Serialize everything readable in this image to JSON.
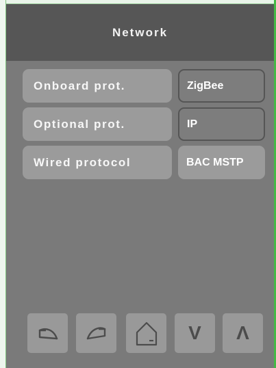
{
  "header": {
    "title": "Network"
  },
  "rows": [
    {
      "label": "Onboard prot.",
      "value": "ZigBee"
    },
    {
      "label": "Optional prot.",
      "value": "IP"
    },
    {
      "label": "Wired protocol",
      "value": "BAC MSTP"
    }
  ],
  "nav": {
    "down_glyph": "V",
    "up_glyph": "Λ"
  },
  "colors": {
    "screen_bg": "#7a7a7a",
    "header_bg": "#565656",
    "button_bg": "#9b9b9b",
    "frame_accent": "#45b845"
  },
  "icons": [
    "undo-icon",
    "redo-icon",
    "home-icon",
    "chevron-down-icon",
    "chevron-up-icon"
  ]
}
